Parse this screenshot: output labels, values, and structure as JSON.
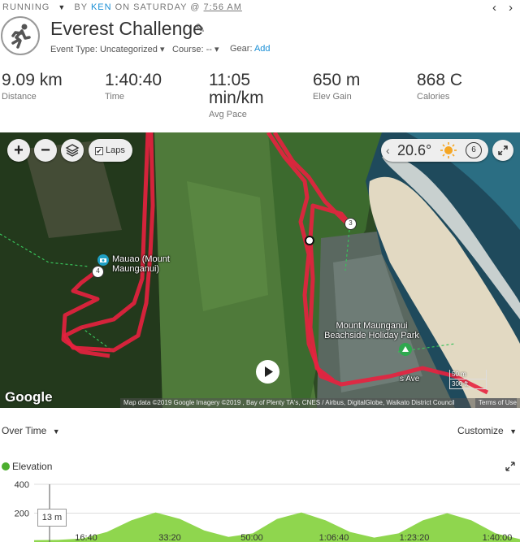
{
  "header": {
    "activity_type": "RUNNING",
    "by_prefix": "BY",
    "user": "KEN",
    "on_day": "ON SATURDAY @",
    "time": "7:56 AM",
    "title": "Everest Challenge",
    "event_type_label": "Event Type:",
    "event_type_value": "Uncategorized",
    "course_label": "Course:",
    "course_value": "--",
    "gear_label": "Gear:",
    "gear_link": "Add"
  },
  "stats": [
    {
      "value": "9.09 km",
      "label": "Distance"
    },
    {
      "value": "1:40:40",
      "label": "Time"
    },
    {
      "value": "11:05\nmin/km",
      "label": "Avg Pace"
    },
    {
      "value": "650 m",
      "label": "Elev Gain"
    },
    {
      "value": "868 C",
      "label": "Calories"
    }
  ],
  "map": {
    "zoom_in": "+",
    "zoom_out": "−",
    "laps_label": "Laps",
    "laps_checked": true,
    "temperature": "20.6°",
    "wind_speed": "6",
    "poi_label": "Mauao (Mount Maunganui)",
    "park_label": "Mount Maunganui Beachside Holiday Park",
    "street_label": "s Ave",
    "lap_markers": [
      "3",
      "4"
    ],
    "google_logo": "Google",
    "attribution": "Map data ©2019 Google Imagery ©2019 , Bay of Plenty TA's, CNES / Airbus, DigitalGlobe, Waikato District Council",
    "terms": "Terms of Use",
    "scale_m": "50 m",
    "scale_ft": "300 ft",
    "route_color": "#e8213f"
  },
  "chart_controls": {
    "over_time": "Over Time",
    "customize": "Customize",
    "legend": "Elevation",
    "legend_color": "#4cae2e",
    "tooltip": "13 m"
  },
  "chart_data": {
    "type": "area",
    "title": "",
    "series": [
      {
        "name": "Elevation",
        "color": "#8fd64e"
      }
    ],
    "y_ticks": [
      "400",
      "200"
    ],
    "x_ticks": [
      "16:40",
      "33:20",
      "50:00",
      "1:06:40",
      "1:23:20",
      "1:40:00"
    ],
    "ylim": [
      0,
      400
    ],
    "x": [
      0,
      5,
      10,
      15,
      20,
      25,
      30,
      35,
      40,
      45,
      50,
      55,
      60,
      65,
      70,
      75,
      80,
      85,
      90,
      95,
      100
    ],
    "values": [
      13,
      15,
      25,
      70,
      150,
      205,
      160,
      80,
      35,
      60,
      160,
      205,
      150,
      70,
      30,
      60,
      150,
      200,
      150,
      60,
      20
    ],
    "x_unit": "minutes"
  }
}
